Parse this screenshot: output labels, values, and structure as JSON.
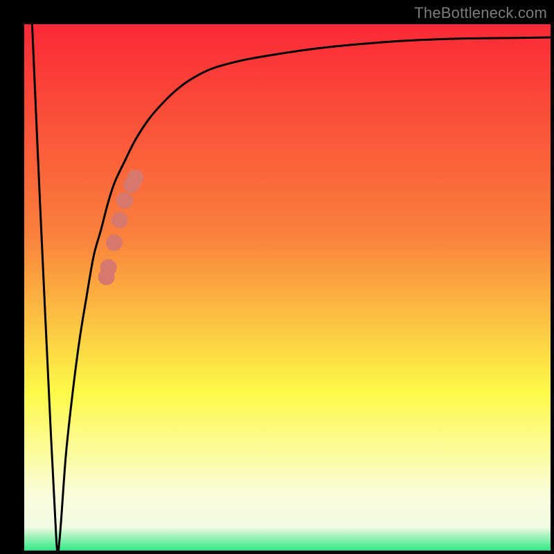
{
  "attribution": "TheBottleneck.com",
  "palette": {
    "frame": "#000000",
    "gradient_top": "#fb2937",
    "gradient_mid_upper": "#fa803c",
    "gradient_mid": "#fdfa48",
    "gradient_mid_lower": "#fafcde",
    "gradient_bottom": "#2fe882",
    "curve_stroke": "#000000",
    "marker_fill": "#d6786c",
    "attribution_text": "#7c7c7c"
  },
  "chart_data": {
    "type": "line",
    "title": "",
    "xlabel": "",
    "ylabel": "",
    "xlim": [
      0,
      100
    ],
    "ylim": [
      0,
      100
    ],
    "grid": false,
    "legend": false,
    "series": [
      {
        "name": "bottleneck-curve",
        "x": [
          1.5,
          3.0,
          4.5,
          6.1,
          6.7,
          7.9,
          9.2,
          10.5,
          11.8,
          13.2,
          14.6,
          15.9,
          17.2,
          19.1,
          21.1,
          23.7,
          26.3,
          28.9,
          31.6,
          35.5,
          40.8,
          46.1,
          52.6,
          59.2,
          67.1,
          75.0,
          84.2,
          93.4,
          100.0
        ],
        "y": [
          100.0,
          66.0,
          34.0,
          2.0,
          2.0,
          18.0,
          30.0,
          40.0,
          48.0,
          56.0,
          61.0,
          66.0,
          70.0,
          74.0,
          78.0,
          82.0,
          85.0,
          87.5,
          89.5,
          91.5,
          93.0,
          94.0,
          95.0,
          95.8,
          96.5,
          97.0,
          97.3,
          97.4,
          97.5
        ]
      }
    ],
    "markers": [
      {
        "name": "highlighted-segment",
        "series": "bottleneck-curve",
        "points": [
          {
            "x": 15.6,
            "y": 52.0
          },
          {
            "x": 16.0,
            "y": 53.8
          },
          {
            "x": 17.1,
            "y": 58.5
          },
          {
            "x": 18.1,
            "y": 62.8
          },
          {
            "x": 19.1,
            "y": 66.5
          },
          {
            "x": 20.4,
            "y": 69.5
          },
          {
            "x": 21.1,
            "y": 70.8
          }
        ]
      }
    ],
    "gradient_stops": [
      {
        "offset": 0.0,
        "color": "#fb2937"
      },
      {
        "offset": 0.4,
        "color": "#fa803c"
      },
      {
        "offset": 0.7,
        "color": "#fdfa48"
      },
      {
        "offset": 0.9,
        "color": "#fafcde"
      },
      {
        "offset": 0.955,
        "color": "#f0fbe2"
      },
      {
        "offset": 1.0,
        "color": "#2fe882"
      }
    ]
  }
}
